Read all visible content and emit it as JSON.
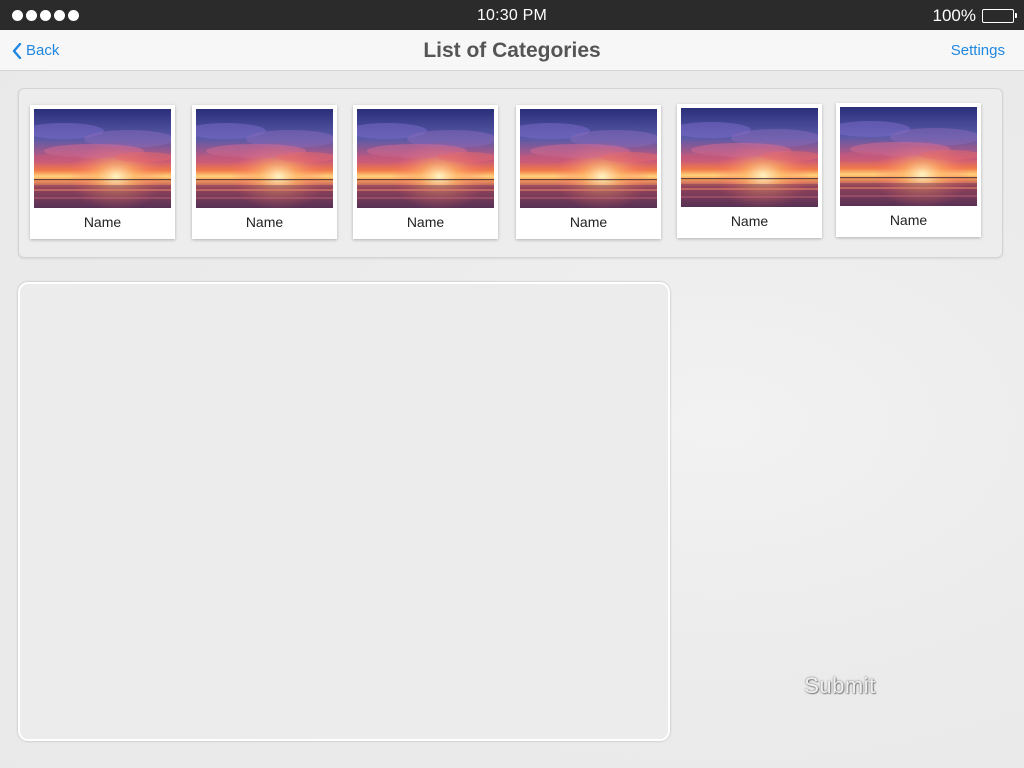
{
  "status_bar": {
    "time": "10:30 PM",
    "battery_percent": "100%",
    "battery_level": 1.0,
    "signal_icon": "signal-dots-icon",
    "battery_icon": "battery-icon"
  },
  "nav": {
    "back_label": "Back",
    "back_icon": "chevron-left-icon",
    "title": "List of Categories",
    "settings_label": "Settings",
    "link_color": "#1f87e0"
  },
  "categories": [
    {
      "name": "Name",
      "image": "sunset-photo"
    },
    {
      "name": "Name",
      "image": "sunset-photo"
    },
    {
      "name": "Name",
      "image": "sunset-photo"
    },
    {
      "name": "Name",
      "image": "sunset-photo"
    },
    {
      "name": "Name",
      "image": "sunset-photo"
    },
    {
      "name": "Name",
      "image": "sunset-photo"
    }
  ],
  "submit_label": "Submit"
}
